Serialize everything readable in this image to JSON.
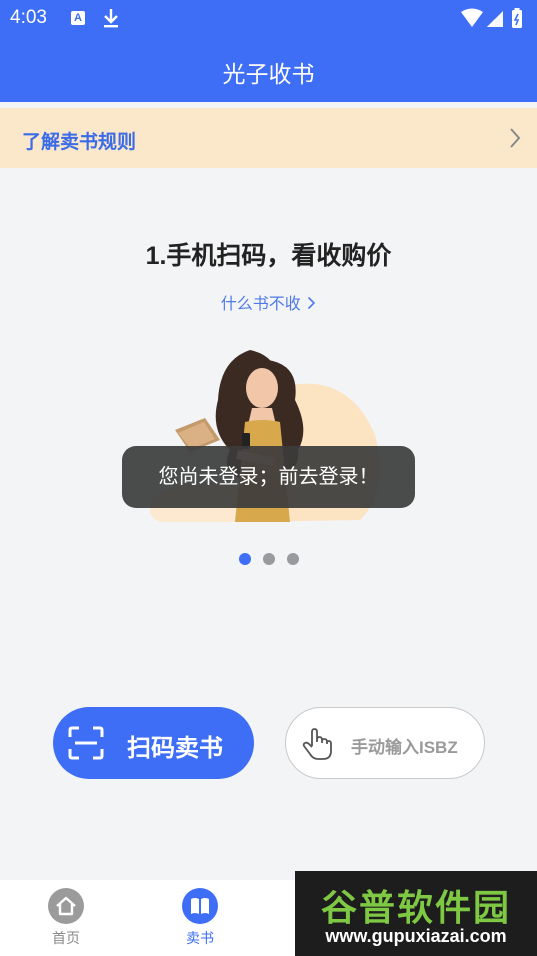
{
  "status_bar": {
    "time": "4:03",
    "icons": [
      "a-notification-icon",
      "download-icon",
      "wifi-icon",
      "signal-icon",
      "battery-icon"
    ]
  },
  "app_bar": {
    "title": "光子收书"
  },
  "rules_banner": {
    "label": "了解卖书规则",
    "icon": "chevron-right-icon"
  },
  "steps": {
    "title": "1.手机扫码，看收购价",
    "link": "什么书不收",
    "link_icon": "chevron-right-icon",
    "carousel": {
      "count": 3,
      "active": 0
    }
  },
  "toast": {
    "message": "您尚未登录；前去登录！"
  },
  "actions": {
    "scan": {
      "label": "扫码卖书",
      "icon": "scan-icon"
    },
    "manual": {
      "label": "手动输入ISBZ",
      "icon": "hand-tap-icon"
    }
  },
  "bottom_nav": {
    "items": [
      {
        "label": "首页",
        "icon": "home-icon",
        "active": false
      },
      {
        "label": "卖书",
        "icon": "book-icon",
        "active": true
      }
    ]
  },
  "watermark": {
    "title": "谷普软件园",
    "url": "www.gupuxiazai.com"
  },
  "colors": {
    "primary": "#3d6ef5",
    "banner_bg": "#fbe8cb",
    "page_bg": "#f3f4f6",
    "toast_bg": "#3c3c3c",
    "watermark_green": "#7ec843"
  }
}
